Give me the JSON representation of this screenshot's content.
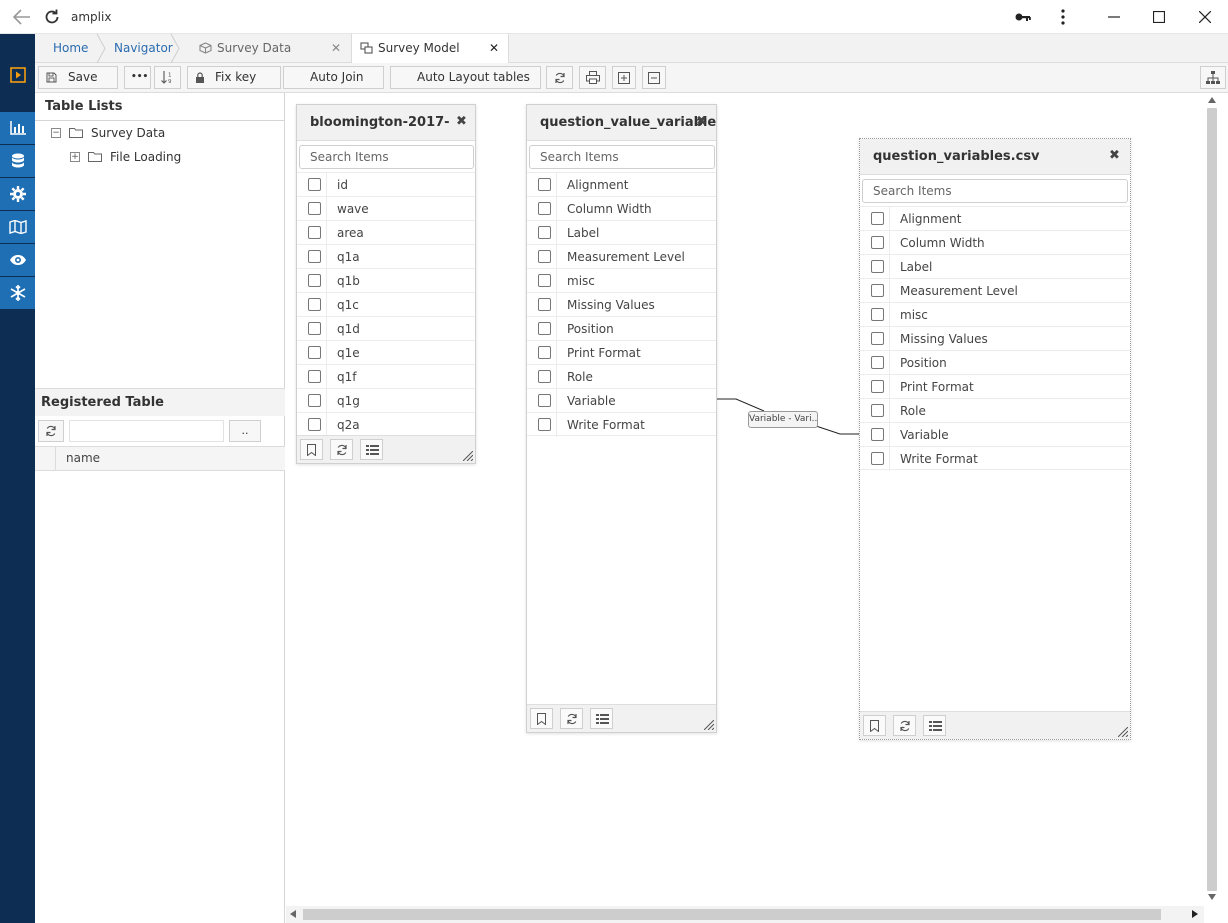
{
  "window": {
    "title": "amplix"
  },
  "breadcrumbs": [
    "Home",
    "Navigator"
  ],
  "tabs": [
    {
      "label": "Survey Data",
      "active": false
    },
    {
      "label": "Survey Model",
      "active": true
    }
  ],
  "toolbar": {
    "save_label": "Save",
    "more_label": "•••",
    "fix_key_label": "Fix key",
    "auto_join_label": "Auto Join",
    "auto_layout_label": "Auto Layout tables"
  },
  "left_panel": {
    "table_lists_title": "Table Lists",
    "tree": [
      {
        "label": "Survey Data",
        "expander": "−",
        "level": 0
      },
      {
        "label": "File Loading",
        "expander": "+",
        "level": 1
      }
    ],
    "registered_title": "Registered Table",
    "registered_more": "..",
    "registered_column": "name"
  },
  "tables": [
    {
      "title": "bloomington-2017-",
      "search_placeholder": "Search Items",
      "items": [
        "id",
        "wave",
        "area",
        "q1a",
        "q1b",
        "q1c",
        "q1d",
        "q1e",
        "q1f",
        "q1g",
        "q2a"
      ]
    },
    {
      "title": "question_value_variable",
      "search_placeholder": "Search Items",
      "items": [
        "Alignment",
        "Column Width",
        "Label",
        "Measurement Level",
        "misc",
        "Missing Values",
        "Position",
        "Print Format",
        "Role",
        "Variable",
        "Write Format"
      ]
    },
    {
      "title": "question_variables.csv",
      "search_placeholder": "Search Items",
      "items": [
        "Alignment",
        "Column Width",
        "Label",
        "Measurement Level",
        "misc",
        "Missing Values",
        "Position",
        "Print Format",
        "Role",
        "Variable",
        "Write Format"
      ]
    }
  ],
  "relation": {
    "label": "Variable - Vari..."
  },
  "colors": {
    "sidebar_dark": "#0d2e52",
    "sidebar_blue": "#1f6fb5",
    "accent_orange": "#f39c12",
    "link_blue": "#2b6cb0"
  }
}
